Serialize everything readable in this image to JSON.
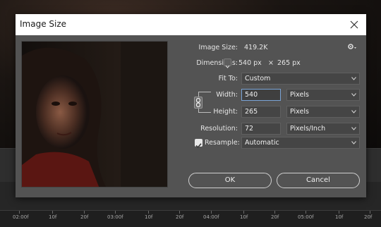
{
  "dialog": {
    "title": "Image Size",
    "image_size_label": "Image Size:",
    "image_size_value": "419.2K",
    "dimensions_label": "Dimensions:",
    "dimensions_width": "540 px",
    "dimensions_x": "×",
    "dimensions_height": "265 px",
    "fit_to_label": "Fit To:",
    "fit_to_value": "Custom",
    "width_label": "Width:",
    "width_value": "540",
    "width_unit": "Pixels",
    "height_label": "Height:",
    "height_value": "265",
    "height_unit": "Pixels",
    "resolution_label": "Resolution:",
    "resolution_value": "72",
    "resolution_unit": "Pixels/Inch",
    "resample_label": "Resample:",
    "resample_checked": true,
    "resample_value": "Automatic",
    "ok_label": "OK",
    "cancel_label": "Cancel"
  },
  "timeline": {
    "ticks": [
      "02:00f",
      "10f",
      "20f",
      "03:00f",
      "10f",
      "20f",
      "04:00f",
      "10f",
      "20f",
      "05:00f",
      "10f",
      "20f"
    ]
  },
  "colors": {
    "dialog_bg": "#535353",
    "field_bg": "#454545",
    "focus_border": "#7aa4d6"
  }
}
